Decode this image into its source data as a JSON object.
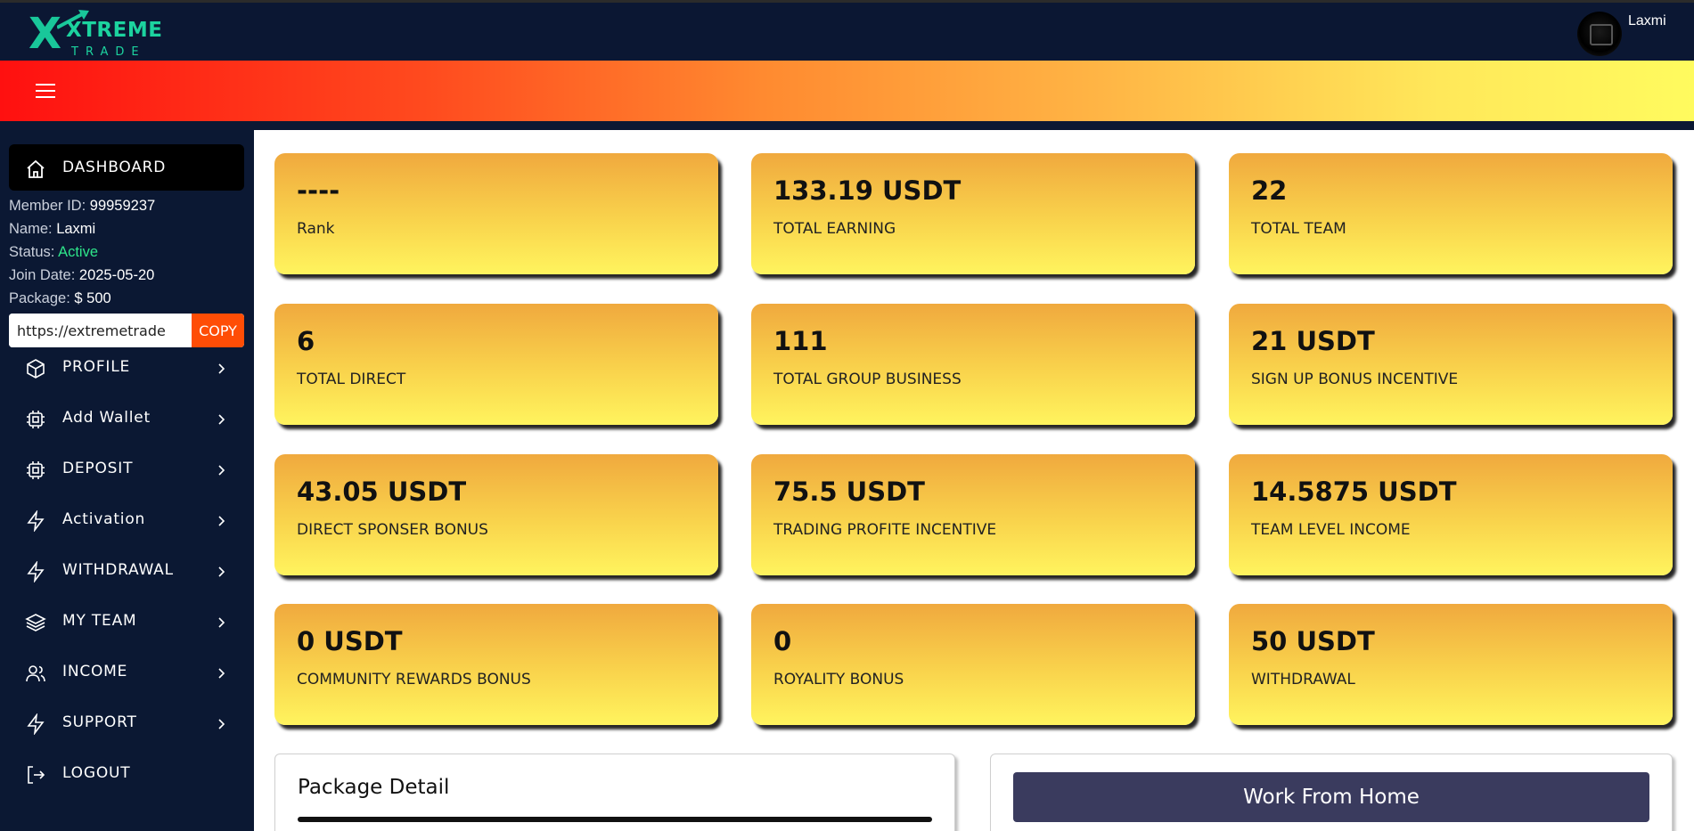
{
  "header": {
    "logo_mark": "X",
    "logo_word_top": "XTREME",
    "logo_word_bottom": "TRADE",
    "user_name": "Laxmi",
    "accent_color": "#19c79a"
  },
  "sidebar": {
    "dashboard_label": "DASHBOARD",
    "member": {
      "id_label": "Member ID:",
      "id_value": "99959237",
      "name_label": "Name:",
      "name_value": "Laxmi",
      "status_label": "Status:",
      "status_value": "Active",
      "join_label": "Join Date:",
      "join_value": "2025-05-20",
      "package_label": "Package:",
      "package_value": "$ 500"
    },
    "referral_value": "https://extremetrade",
    "copy_label": "COPY",
    "items": [
      {
        "label": "PROFILE",
        "icon": "cube-icon"
      },
      {
        "label": "Add Wallet",
        "icon": "chip-icon"
      },
      {
        "label": "DEPOSIT",
        "icon": "chip-icon"
      },
      {
        "label": "Activation",
        "icon": "bolt-icon"
      },
      {
        "label": "WITHDRAWAL",
        "icon": "bolt-icon"
      },
      {
        "label": "MY TEAM",
        "icon": "layers-icon"
      },
      {
        "label": "INCOME",
        "icon": "users-icon"
      },
      {
        "label": "SUPPORT",
        "icon": "bolt-icon"
      },
      {
        "label": "LOGOUT",
        "icon": "logout-icon"
      }
    ]
  },
  "cards": [
    {
      "value": "----",
      "label": "Rank"
    },
    {
      "value": "133.19 USDT",
      "label": "TOTAL EARNING"
    },
    {
      "value": "22",
      "label": "TOTAL TEAM"
    },
    {
      "value": "6",
      "label": "TOTAL DIRECT"
    },
    {
      "value": "111",
      "label": "TOTAL GROUP BUSINESS"
    },
    {
      "value": "21 USDT",
      "label": "SIGN UP BONUS INCENTIVE"
    },
    {
      "value": "43.05 USDT",
      "label": "DIRECT SPONSER BONUS"
    },
    {
      "value": "75.5 USDT",
      "label": "TRADING PROFITE INCENTIVE"
    },
    {
      "value": "14.5875 USDT",
      "label": "TEAM LEVEL INCOME"
    },
    {
      "value": "0 USDT",
      "label": "COMMUNITY REWARDS BONUS"
    },
    {
      "value": "0",
      "label": "ROYALITY BONUS"
    },
    {
      "value": "50 USDT",
      "label": "WITHDRAWAL"
    }
  ],
  "package_panel": {
    "title": "Package Detail"
  },
  "work_panel": {
    "button_label": "Work From Home"
  }
}
